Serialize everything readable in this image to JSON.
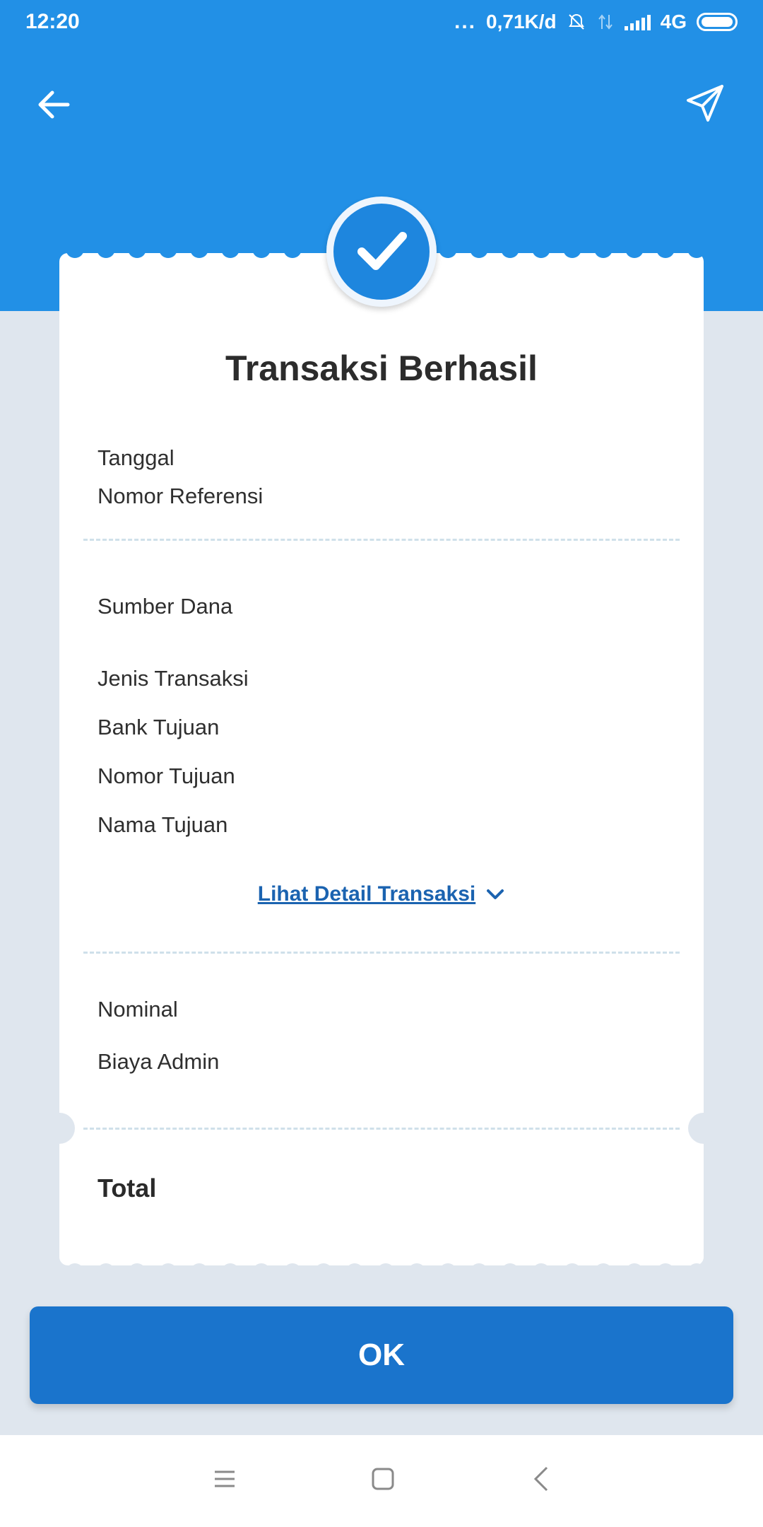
{
  "status_bar": {
    "time": "12:20",
    "dots": "...",
    "speed": "0,71K/d",
    "network": "4G"
  },
  "appbar": {
    "back_icon": "arrow-left-icon",
    "share_icon": "send-icon"
  },
  "receipt": {
    "title": "Transaksi Berhasil",
    "rows_top": [
      "Tanggal",
      "Nomor Referensi"
    ],
    "sumber_dana": "Sumber Dana",
    "details": [
      "Jenis Transaksi",
      "Bank Tujuan",
      "Nomor Tujuan",
      "Nama Tujuan"
    ],
    "detail_link": "Lihat Detail Transaksi",
    "amounts": [
      "Nominal",
      "Biaya Admin"
    ],
    "total_label": "Total"
  },
  "ok_button": "OK",
  "colors": {
    "header_blue": "#2290e6",
    "button_blue": "#1a74cc",
    "link_blue": "#1b63b0",
    "background": "#dfe6ee"
  }
}
